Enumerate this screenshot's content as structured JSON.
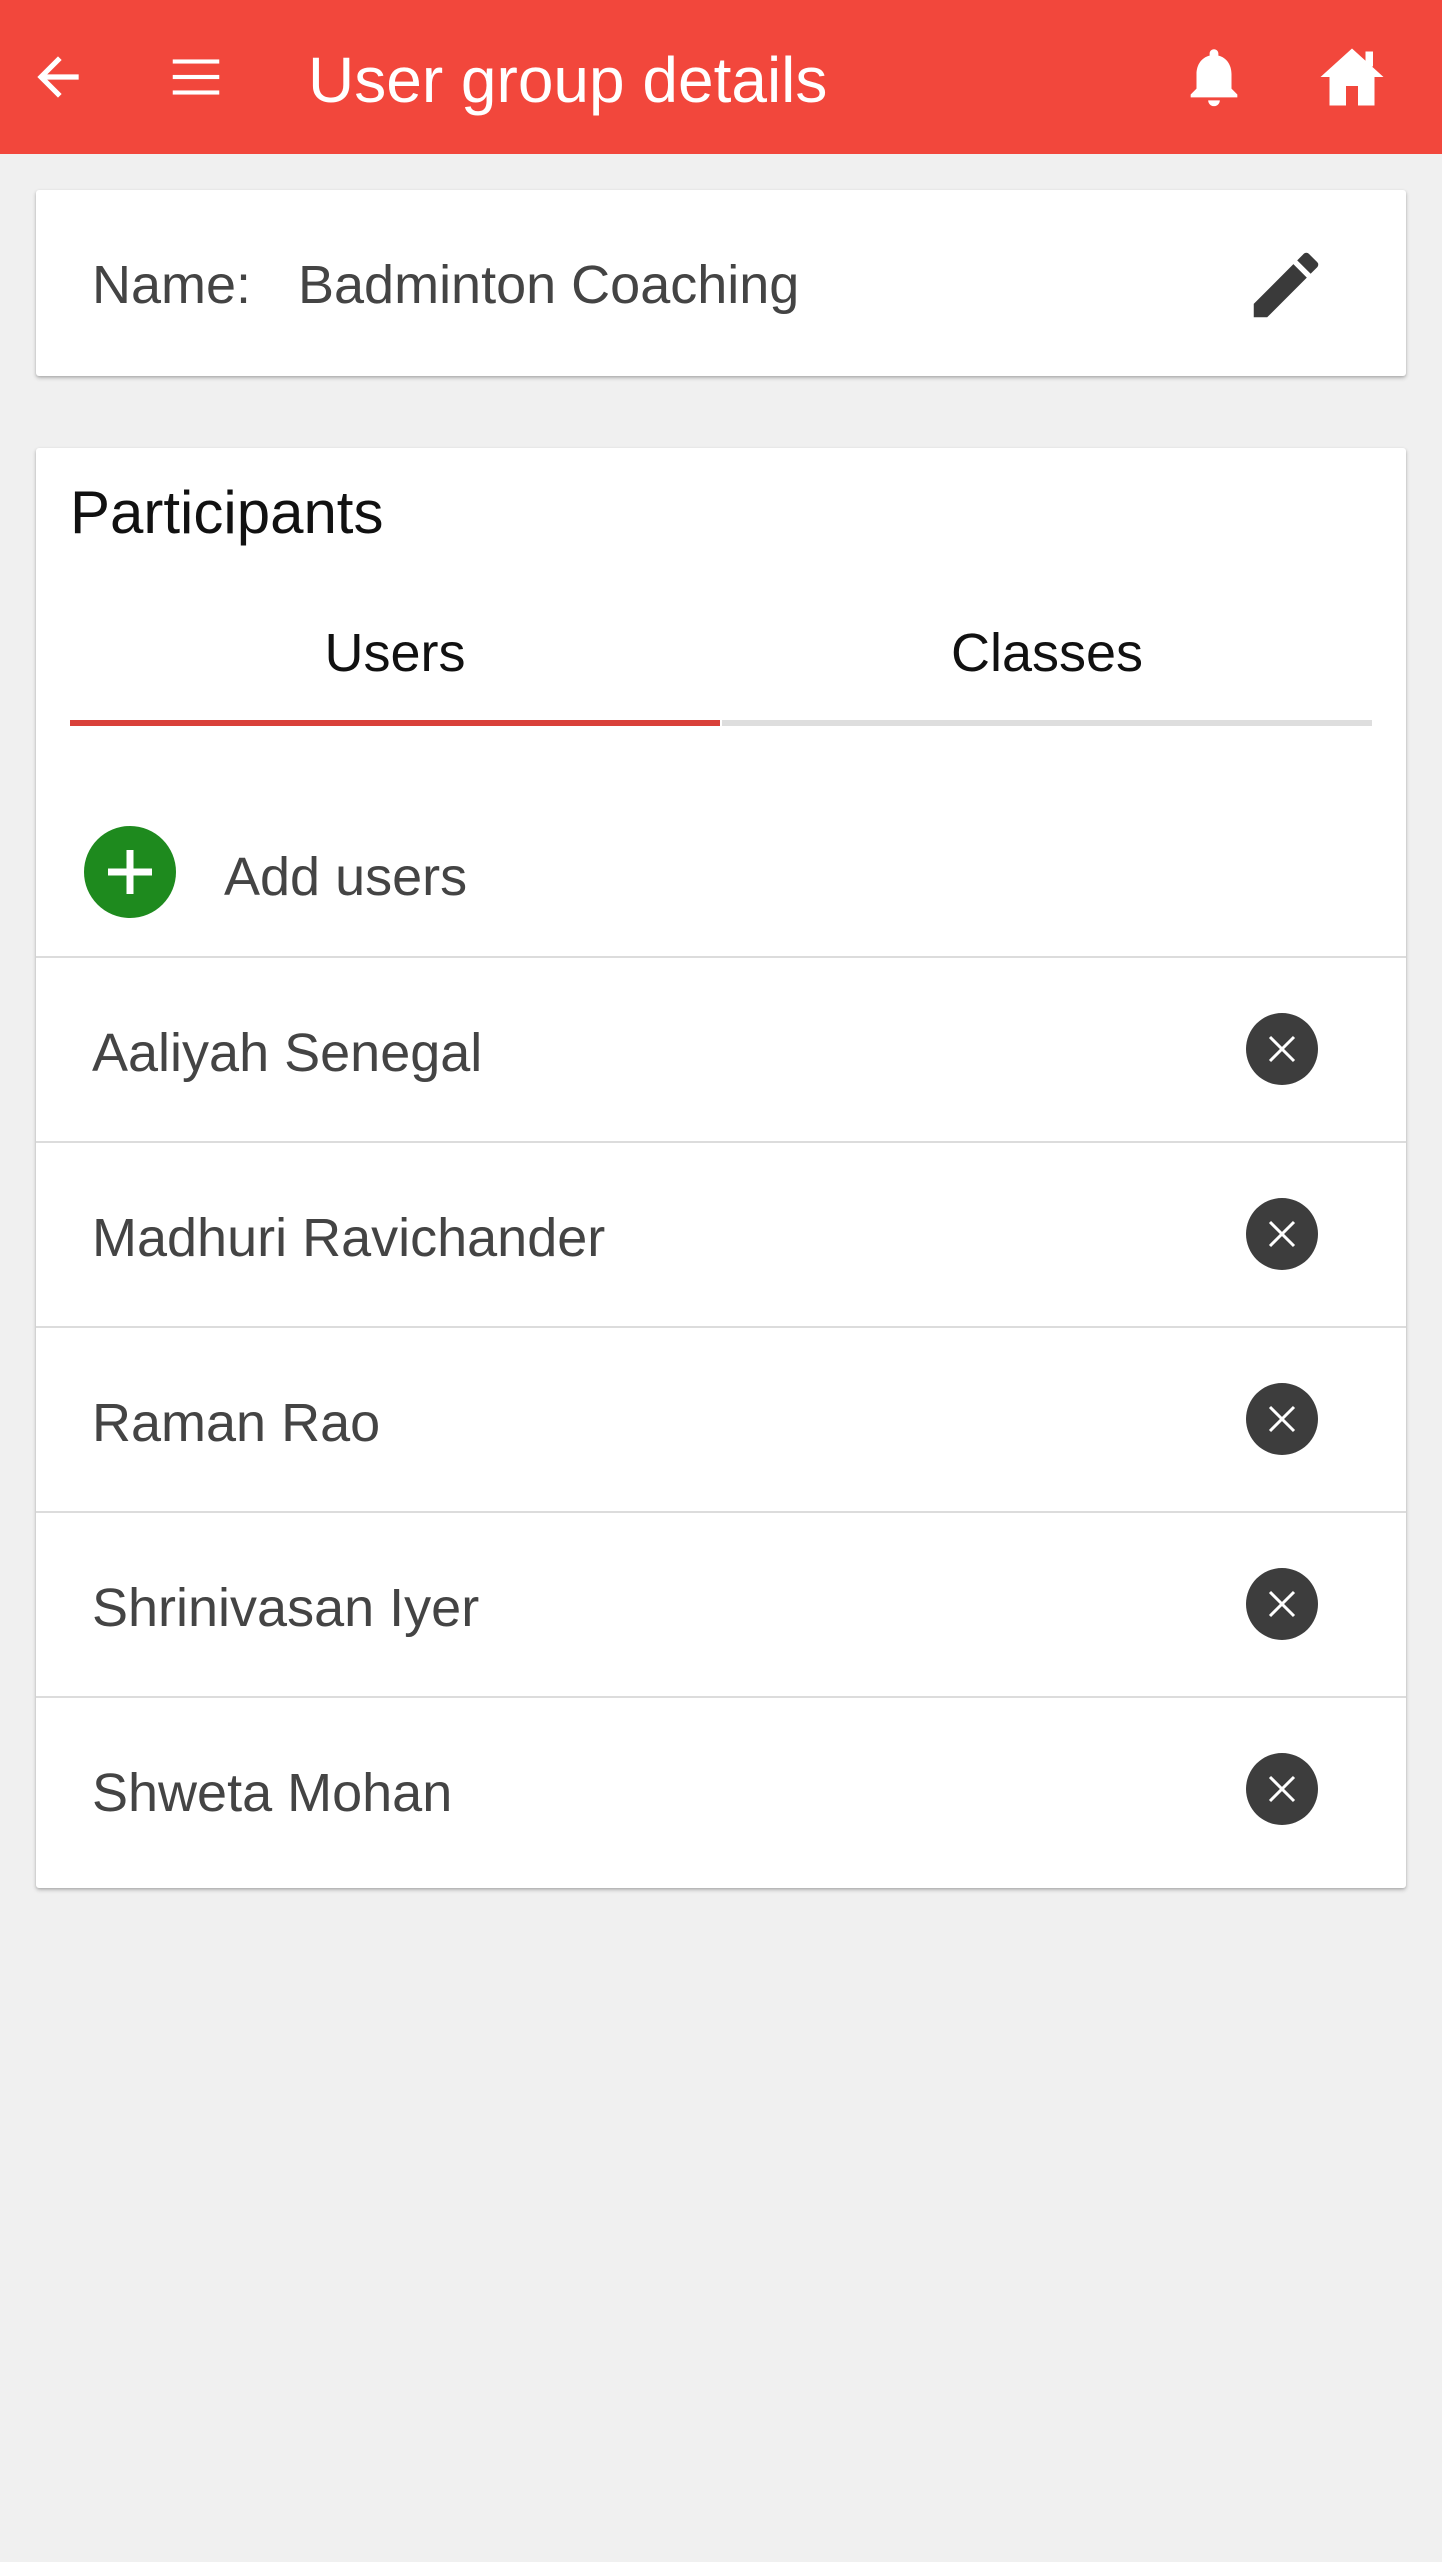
{
  "appbar": {
    "title": "User group details",
    "back_icon": "arrow-left-icon",
    "menu_icon": "hamburger-menu-icon",
    "notification_icon": "bell-icon",
    "home_icon": "home-icon",
    "background_color": "#f2473c"
  },
  "group": {
    "name_label": "Name:",
    "name_value": "Badminton Coaching",
    "edit_icon": "pencil-icon"
  },
  "participants": {
    "title": "Participants",
    "tabs": [
      {
        "label": "Users",
        "selected": true
      },
      {
        "label": "Classes",
        "selected": false
      }
    ],
    "add_label": "Add users",
    "add_icon": "plus-circle-icon",
    "add_color": "#1e8a1e",
    "remove_icon": "close-circle-icon",
    "users": [
      {
        "name": "Aaliyah Senegal"
      },
      {
        "name": "Madhuri Ravichander"
      },
      {
        "name": "Raman Rao"
      },
      {
        "name": "Shrinivasan Iyer"
      },
      {
        "name": "Shweta Mohan"
      }
    ]
  },
  "colors": {
    "tab_active_indicator": "#d9413a",
    "tab_inactive_indicator": "#dedede",
    "page_background": "#f0f0f0"
  }
}
